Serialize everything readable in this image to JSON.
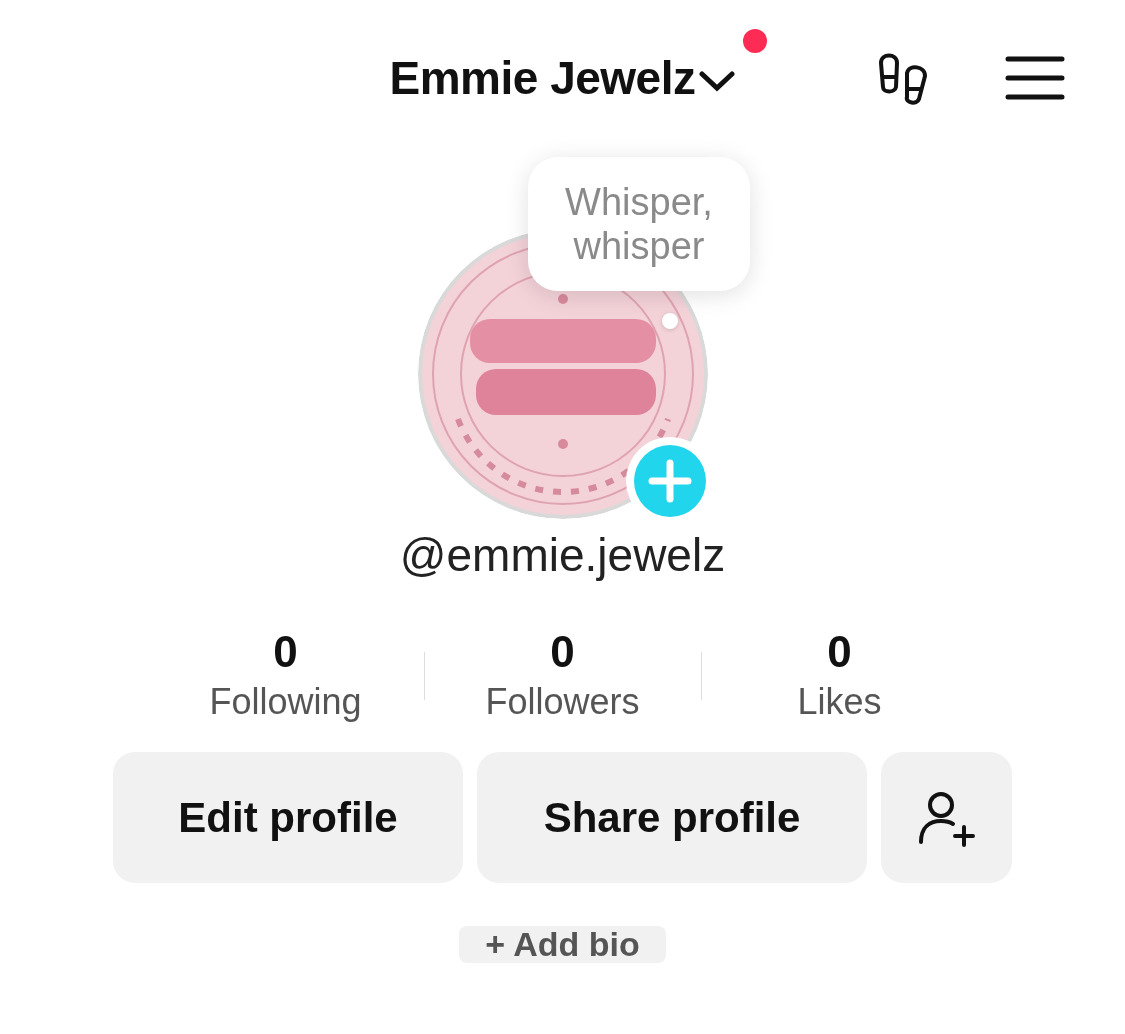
{
  "header": {
    "title": "Emmie Jewelz",
    "notification_dot": true
  },
  "avatar": {
    "kind": "picture",
    "note_bubble": "Whisper, whisper"
  },
  "handle": "@emmie.jewelz",
  "stats": [
    {
      "value": "0",
      "label": "Following"
    },
    {
      "value": "0",
      "label": "Followers"
    },
    {
      "value": "0",
      "label": "Likes"
    }
  ],
  "buttons": [
    {
      "kind": "text",
      "label": "Edit profile"
    },
    {
      "kind": "text",
      "label": "Share profile"
    },
    {
      "kind": "icon"
    }
  ],
  "add_bio": "+ Add bio"
}
